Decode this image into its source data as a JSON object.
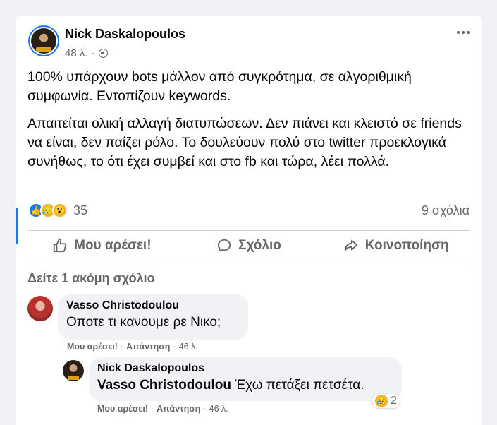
{
  "post": {
    "author": "Nick Daskalopoulos",
    "time": "48 λ.",
    "separator": "·",
    "paragraphs": [
      "100% υπάρχουν bots μάλλον από συγκρότημα, σε αλγοριθμική συμφωνία. Εντοπίζουν keywords.",
      "Απαιτείται ολική αλλαγή διατυπώσεων. Δεν πιάνει και κλειστό σε friends να είναι, δεν παίζει ρόλο. Το δουλεύουν πολύ στο twitter προεκλογικά συνήθως, το ότι έχει συμβεί και στο fb και τώρα, λέει πολλά."
    ],
    "reactions_count": "35",
    "comments_count": "9 σχόλια"
  },
  "actions": {
    "like": "Μου αρέσει!",
    "comment": "Σχόλιο",
    "share": "Κοινοποίηση"
  },
  "more_comments": "Δείτε 1 ακόμη σχόλιο",
  "comments": [
    {
      "name": "Vasso Christodoulou",
      "text": "Οποτε τι κανουμε ρε Νικο;",
      "like": "Μου αρέσει!",
      "reply": "Απάντηση",
      "time": "46 λ."
    },
    {
      "name": "Nick Daskalopoulos",
      "tag": "Vasso Christodoulou",
      "text": " Έχω πετάξει πετσέτα.",
      "like": "Μου αρέσει!",
      "reply": "Απάντηση",
      "time": "46 λ.",
      "reactions_count": "2"
    }
  ],
  "colors": {
    "accent": "#1877f2",
    "secondary_text": "#65676b",
    "bubble": "#f0f2f5"
  }
}
